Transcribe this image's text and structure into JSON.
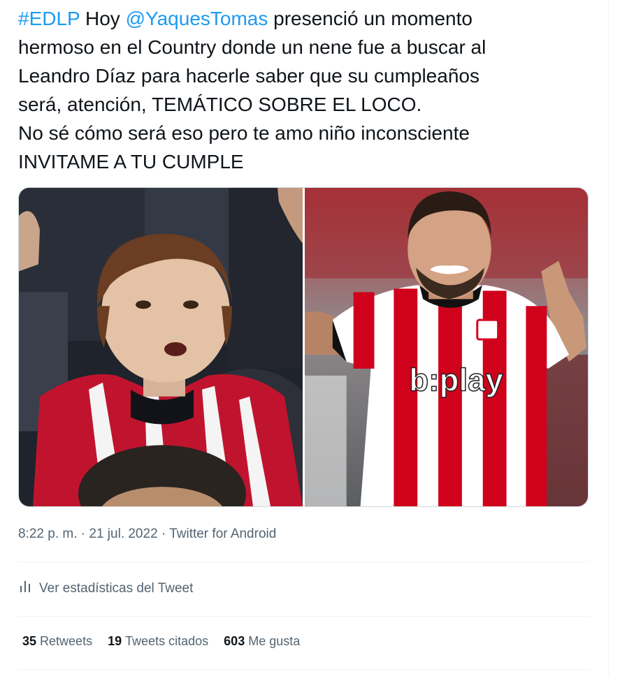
{
  "tweet": {
    "hashtag": "#EDLP",
    "text_part1": " Hoy ",
    "mention": "@YaquesTomas",
    "text_part2": " presenció un momento",
    "line2": "hermoso en el Country donde un nene fue a buscar al",
    "line3": "Leandro Díaz para hacerle saber que su cumpleaños",
    "line4": "será, atención, TEMÁTICO SOBRE EL LOCO.",
    "line5": "No sé cómo será eso pero te amo niño inconsciente",
    "line6": "INVITAME A TU CUMPLE"
  },
  "media": {
    "left_photo": "child-fan-photo",
    "right_photo": "player-celebrating-photo",
    "jersey_sponsor": "b:play"
  },
  "meta": {
    "time": "8:22 p. m.",
    "sep1": " · ",
    "date": "21 jul. 2022",
    "sep2": " · ",
    "source": "Twitter for Android"
  },
  "stats_link": {
    "label": "Ver estadísticas del Tweet",
    "icon": "bar-chart-icon"
  },
  "counts": {
    "retweets_num": "35",
    "retweets_label": "Retweets",
    "quotes_num": "19",
    "quotes_label": "Tweets citados",
    "likes_num": "603",
    "likes_label": "Me gusta"
  },
  "colors": {
    "link": "#1d9bf0",
    "text": "#0f1419",
    "secondary": "#536471",
    "divider": "#eff3f4",
    "jersey_red": "#d0021b"
  }
}
